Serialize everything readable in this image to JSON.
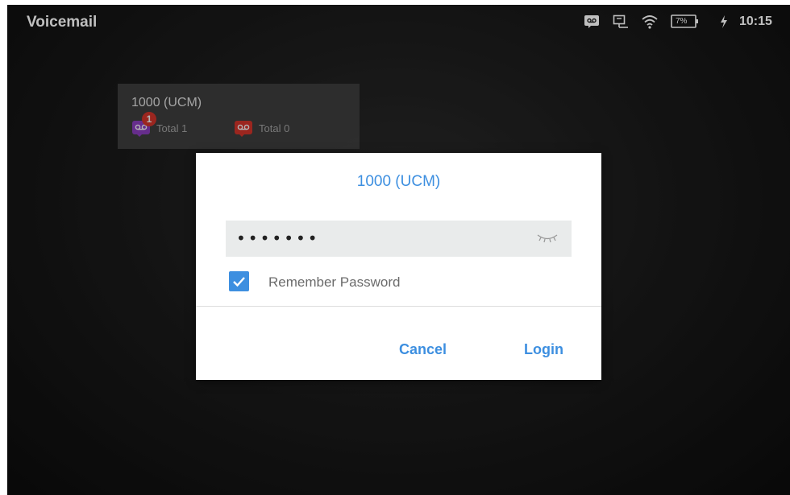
{
  "app": {
    "title": "Voicemail"
  },
  "status_bar": {
    "icons": [
      "voicemail-icon",
      "network-icon",
      "wifi-icon",
      "battery-icon",
      "charging-icon"
    ],
    "battery_text": "7%",
    "time": "10:15"
  },
  "account_card": {
    "name": "1000 (UCM)",
    "new_messages": {
      "badge": "1",
      "label": "Total 1",
      "color": "#8e3fc4"
    },
    "old_messages": {
      "label": "Total 0",
      "color": "#d9352b"
    }
  },
  "login_dialog": {
    "title": "1000 (UCM)",
    "password_value": "•••••••",
    "remember_password": {
      "label": "Remember Password",
      "checked": true
    },
    "buttons": {
      "cancel": "Cancel",
      "login": "Login"
    }
  },
  "colors": {
    "accent": "#3d8fe0",
    "dialog_bg": "#ffffff",
    "field_bg": "#e9ebeb",
    "badge": "#d9352b"
  }
}
